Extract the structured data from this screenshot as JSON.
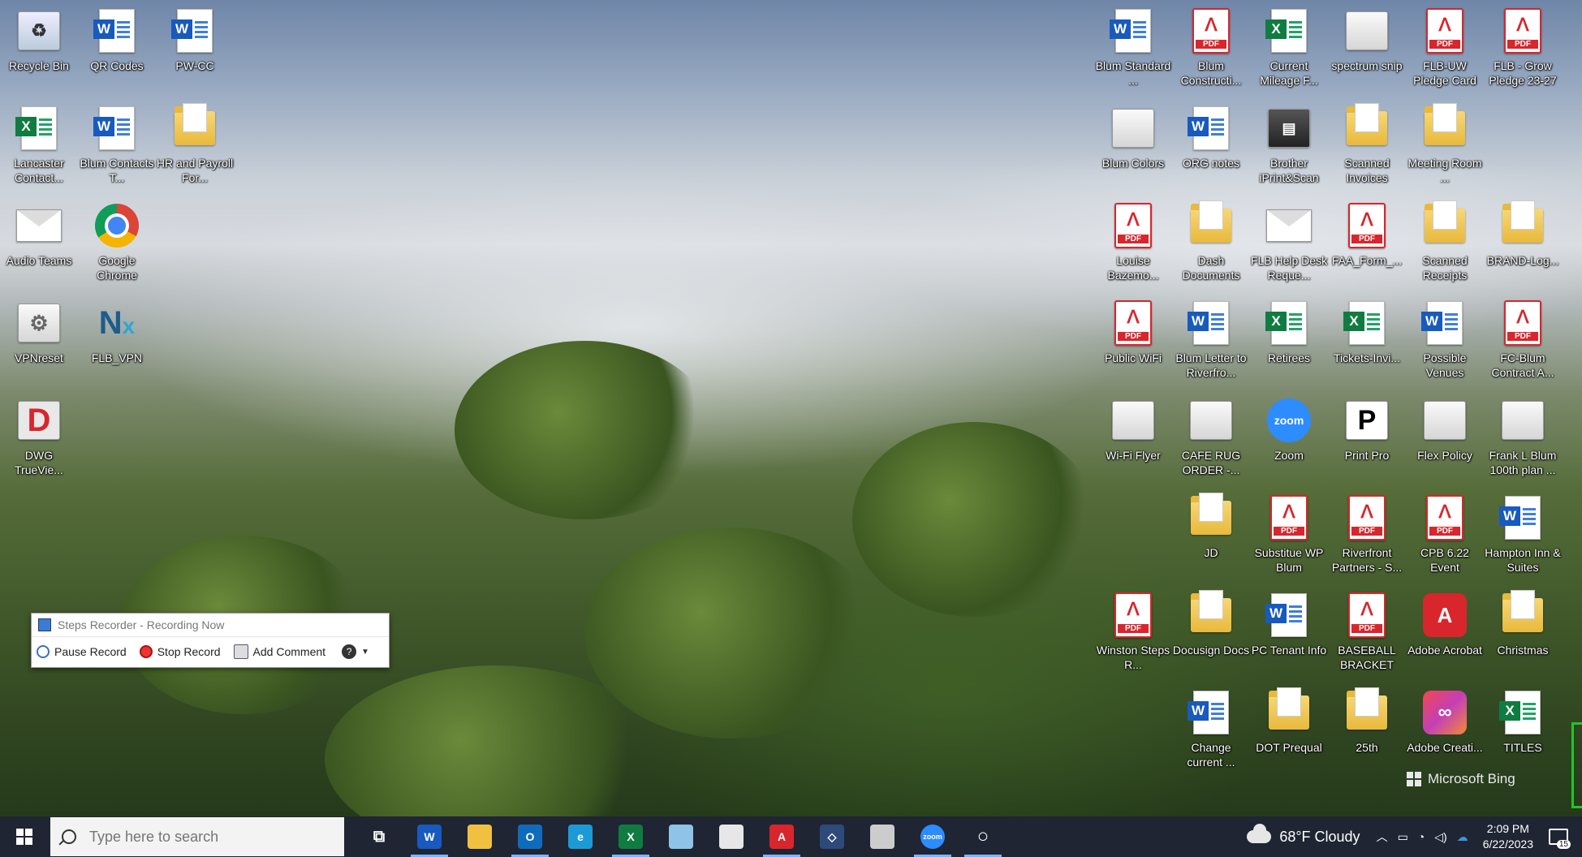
{
  "desktop": {
    "left_icons": [
      {
        "label": "Recycle Bin",
        "type": "recycle"
      },
      {
        "label": "QR Codes",
        "type": "word"
      },
      {
        "label": "PW-CC",
        "type": "word"
      },
      {
        "label": "Lancaster Contact...",
        "type": "excel"
      },
      {
        "label": "Blum Contacts T...",
        "type": "word"
      },
      {
        "label": "HR and Payroll For...",
        "type": "folder"
      },
      {
        "label": "Audio Teams",
        "type": "envelope"
      },
      {
        "label": "Google Chrome",
        "type": "chrome"
      },
      {
        "label": "VPNreset",
        "type": "gear"
      },
      {
        "label": "FLB_VPN",
        "type": "nx"
      },
      {
        "label": "DWG TrueVie...",
        "type": "dwg"
      }
    ],
    "right_icons": [
      {
        "label": "Blum Standard ...",
        "type": "word"
      },
      {
        "label": "Blum Constructi...",
        "type": "pdf"
      },
      {
        "label": "Current Mileage F...",
        "type": "excel"
      },
      {
        "label": "spectrum snip",
        "type": "generic"
      },
      {
        "label": "FLB-UW Pledge Card",
        "type": "pdf"
      },
      {
        "label": "FLB - Grow Pledge 23-27",
        "type": "pdf"
      },
      {
        "label": "Blum Colors",
        "type": "generic"
      },
      {
        "label": "ORG notes",
        "type": "word"
      },
      {
        "label": "Brother iPrint&Scan",
        "type": "printer"
      },
      {
        "label": "Scanned Invoices",
        "type": "folder"
      },
      {
        "label": "Meeting Room ...",
        "type": "folder"
      },
      {
        "label": "Louise Bazemo...",
        "type": "pdf"
      },
      {
        "label": "Dash Documents",
        "type": "folder"
      },
      {
        "label": "FLB Help Desk Reque...",
        "type": "envelope"
      },
      {
        "label": "FAA_Form_...",
        "type": "pdf"
      },
      {
        "label": "Scanned Receipts",
        "type": "folder"
      },
      {
        "label": "BRAND-Log...",
        "type": "folder"
      },
      {
        "label": "Public WiFi",
        "type": "pdf"
      },
      {
        "label": "Blum Letter to Riverfro...",
        "type": "word"
      },
      {
        "label": "Retirees",
        "type": "excel"
      },
      {
        "label": "Tickets-Invi...",
        "type": "excel"
      },
      {
        "label": "Possible Venues",
        "type": "word"
      },
      {
        "label": "FC-Blum Contract A...",
        "type": "pdf"
      },
      {
        "label": "Wi-Fi Flyer",
        "type": "generic"
      },
      {
        "label": "CAFE RUG ORDER -...",
        "type": "generic"
      },
      {
        "label": "Zoom",
        "type": "zoom"
      },
      {
        "label": "Print Pro",
        "type": "printpro"
      },
      {
        "label": "Flex Policy",
        "type": "generic"
      },
      {
        "label": "Frank L Blum 100th plan ...",
        "type": "generic"
      },
      {
        "label": "JD",
        "type": "folder"
      },
      {
        "label": "Substitue WP Blum",
        "type": "pdf"
      },
      {
        "label": "Riverfront Partners - S...",
        "type": "pdf"
      },
      {
        "label": "CPB 6.22 Event",
        "type": "pdf"
      },
      {
        "label": "Hampton Inn & Suites",
        "type": "word"
      },
      {
        "label": "Winston Steps R...",
        "type": "pdf"
      },
      {
        "label": "Docusign Docs",
        "type": "folder"
      },
      {
        "label": "PC Tenant Info",
        "type": "word"
      },
      {
        "label": "BASEBALL BRACKET",
        "type": "pdf"
      },
      {
        "label": "Adobe Acrobat",
        "type": "acrobat"
      },
      {
        "label": "Christmas",
        "type": "folder"
      },
      {
        "label": "Change current ...",
        "type": "word"
      },
      {
        "label": "DOT Prequal",
        "type": "folder"
      },
      {
        "label": "25th",
        "type": "folder"
      },
      {
        "label": "Adobe Creati...",
        "type": "creative"
      },
      {
        "label": "TITLES",
        "type": "excel"
      }
    ],
    "watermark": "Microsoft Bing"
  },
  "steps_recorder": {
    "title": "Steps Recorder - Recording Now",
    "pause_label": "Pause Record",
    "stop_label": "Stop Record",
    "comment_label": "Add Comment",
    "help_label": "?"
  },
  "taskbar": {
    "search_placeholder": "Type here to search",
    "apps": [
      {
        "name": "task-view",
        "glyph": "⧉",
        "color": "transparent"
      },
      {
        "name": "word",
        "glyph": "W",
        "color": "#185abd"
      },
      {
        "name": "file-explorer",
        "glyph": "",
        "color": "#f0c040"
      },
      {
        "name": "outlook",
        "glyph": "O",
        "color": "#0f6cbd"
      },
      {
        "name": "edge",
        "glyph": "e",
        "color": "#1c9ad6"
      },
      {
        "name": "excel",
        "glyph": "X",
        "color": "#107c41"
      },
      {
        "name": "notepad",
        "glyph": "",
        "color": "#8fc3e8"
      },
      {
        "name": "paint",
        "glyph": "",
        "color": "#e7e7e7"
      },
      {
        "name": "acrobat",
        "glyph": "A",
        "color": "#d8262c"
      },
      {
        "name": "defender",
        "glyph": "◇",
        "color": "#2e4a7a"
      },
      {
        "name": "snipping",
        "glyph": "",
        "color": "#cccccc"
      },
      {
        "name": "zoom",
        "glyph": "zoom",
        "color": "#2d8cff"
      },
      {
        "name": "steps-recorder",
        "glyph": "○",
        "color": "transparent"
      }
    ],
    "weather": "68°F Cloudy",
    "time": "2:09 PM",
    "date": "6/22/2023",
    "notification_count": "15"
  }
}
